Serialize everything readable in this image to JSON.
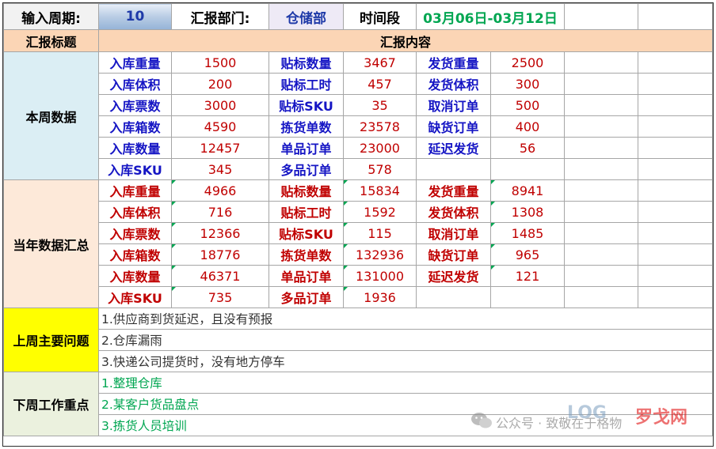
{
  "header": {
    "period_label": "输入周期:",
    "period_value": "10",
    "dept_label": "汇报部门:",
    "dept_value": "仓储部",
    "time_label": "时间段",
    "time_value": "03月06日-03月12日"
  },
  "subheader": {
    "title_col": "汇报标题",
    "content_col": "汇报内容"
  },
  "week": {
    "section": "本周数据",
    "rows": [
      {
        "l1": "入库重量",
        "v1": "1500",
        "l2": "贴标数量",
        "v2": "3467",
        "l3": "发货重量",
        "v3": "2500"
      },
      {
        "l1": "入库体积",
        "v1": "200",
        "l2": "贴标工时",
        "v2": "457",
        "l3": "发货体积",
        "v3": "300"
      },
      {
        "l1": "入库票数",
        "v1": "3000",
        "l2": "贴标SKU",
        "v2": "35",
        "l3": "取消订单",
        "v3": "500"
      },
      {
        "l1": "入库箱数",
        "v1": "4590",
        "l2": "拣货单数",
        "v2": "23578",
        "l3": "缺货订单",
        "v3": "400"
      },
      {
        "l1": "入库数量",
        "v1": "12457",
        "l2": "单品订单",
        "v2": "23000",
        "l3": "延迟发货",
        "v3": "56"
      },
      {
        "l1": "入库SKU",
        "v1": "345",
        "l2": "多品订单",
        "v2": "578",
        "l3": "",
        "v3": ""
      }
    ]
  },
  "year": {
    "section": "当年数据汇总",
    "rows": [
      {
        "l1": "入库重量",
        "v1": "4966",
        "l2": "贴标数量",
        "v2": "15834",
        "l3": "发货重量",
        "v3": "8941"
      },
      {
        "l1": "入库体积",
        "v1": "716",
        "l2": "贴标工时",
        "v2": "1592",
        "l3": "发货体积",
        "v3": "1308"
      },
      {
        "l1": "入库票数",
        "v1": "12366",
        "l2": "贴标SKU",
        "v2": "115",
        "l3": "取消订单",
        "v3": "1485"
      },
      {
        "l1": "入库箱数",
        "v1": "18776",
        "l2": "拣货单数",
        "v2": "132936",
        "l3": "缺货订单",
        "v3": "965"
      },
      {
        "l1": "入库数量",
        "v1": "46371",
        "l2": "单品订单",
        "v2": "131000",
        "l3": "延迟发货",
        "v3": "121"
      },
      {
        "l1": "入库SKU",
        "v1": "735",
        "l2": "多品订单",
        "v2": "1936",
        "l3": "",
        "v3": ""
      }
    ]
  },
  "problems": {
    "section": "上周主要问题",
    "items": [
      "1.供应商到货延迟，且没有预报",
      "2.仓库漏雨",
      "3.快递公司提货时，没有地方停车"
    ]
  },
  "plans": {
    "section": "下周工作重点",
    "items": [
      "1.整理仓库",
      "2.某客户货品盘点",
      "3.拣货人员培训"
    ]
  },
  "watermark": {
    "account": "公众号 · 致敬在于格物",
    "brand": "LOG",
    "brand_cn": "罗戈网"
  },
  "colors": {
    "label_week": "#1515c4",
    "label_year": "#c00000",
    "value": "#c00000",
    "green_text": "#00a651",
    "problem_fill": "#ffff00"
  }
}
